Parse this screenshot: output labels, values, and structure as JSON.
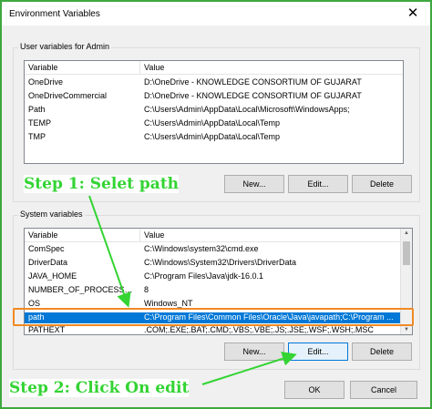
{
  "window": {
    "title": "Environment Variables",
    "close_glyph": "✕"
  },
  "user_vars": {
    "group_label": "User variables for Admin",
    "columns": [
      "Variable",
      "Value"
    ],
    "rows": [
      {
        "variable": "OneDrive",
        "value": "D:\\OneDrive - KNOWLEDGE CONSORTIUM OF GUJARAT"
      },
      {
        "variable": "OneDriveCommercial",
        "value": "D:\\OneDrive - KNOWLEDGE CONSORTIUM OF GUJARAT"
      },
      {
        "variable": "Path",
        "value": "C:\\Users\\Admin\\AppData\\Local\\Microsoft\\WindowsApps;"
      },
      {
        "variable": "TEMP",
        "value": "C:\\Users\\Admin\\AppData\\Local\\Temp"
      },
      {
        "variable": "TMP",
        "value": "C:\\Users\\Admin\\AppData\\Local\\Temp"
      }
    ],
    "buttons": {
      "new": "New...",
      "edit": "Edit...",
      "delete": "Delete"
    }
  },
  "system_vars": {
    "group_label": "System variables",
    "columns": [
      "Variable",
      "Value"
    ],
    "rows": [
      {
        "variable": "ComSpec",
        "value": "C:\\Windows\\system32\\cmd.exe"
      },
      {
        "variable": "DriverData",
        "value": "C:\\Windows\\System32\\Drivers\\DriverData"
      },
      {
        "variable": "JAVA_HOME",
        "value": "C:\\Program Files\\Java\\jdk-16.0.1"
      },
      {
        "variable": "NUMBER_OF_PROCESSORS",
        "value": "8"
      },
      {
        "variable": "OS",
        "value": "Windows_NT"
      },
      {
        "variable": "path",
        "value": "C:\\Program Files\\Common Files\\Oracle\\Java\\javapath;C:\\Program ..."
      },
      {
        "variable": "PATHEXT",
        "value": ".COM;.EXE;.BAT;.CMD;.VBS;.VBE;.JS;.JSE;.WSF;.WSH;.MSC"
      }
    ],
    "selected_index": 5,
    "buttons": {
      "new": "New...",
      "edit": "Edit...",
      "delete": "Delete"
    }
  },
  "dialog_buttons": {
    "ok": "OK",
    "cancel": "Cancel"
  },
  "annotations": {
    "step1": "Step 1: Selet path",
    "step2": "Step 2: Click On edit"
  },
  "colors": {
    "annotation_green": "#33d433",
    "selection_blue": "#0078d7",
    "highlight_orange": "#f08a24",
    "window_border": "#3ea83e"
  }
}
